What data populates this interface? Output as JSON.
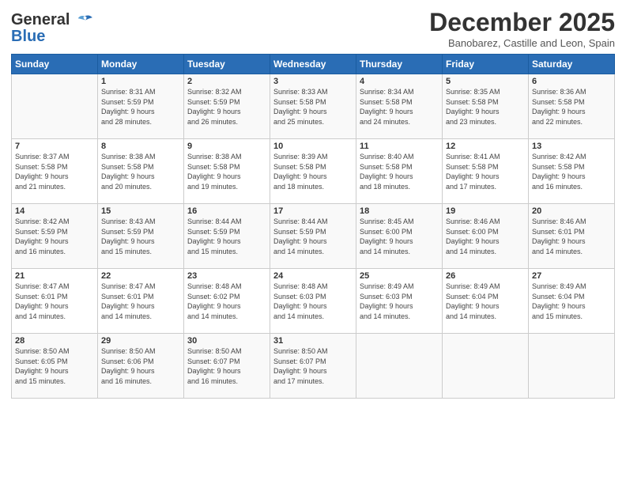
{
  "header": {
    "logo_line1": "General",
    "logo_line2": "Blue",
    "month": "December 2025",
    "location": "Banobarez, Castille and Leon, Spain"
  },
  "days_of_week": [
    "Sunday",
    "Monday",
    "Tuesday",
    "Wednesday",
    "Thursday",
    "Friday",
    "Saturday"
  ],
  "weeks": [
    [
      {
        "day": "",
        "info": ""
      },
      {
        "day": "1",
        "info": "Sunrise: 8:31 AM\nSunset: 5:59 PM\nDaylight: 9 hours\nand 28 minutes."
      },
      {
        "day": "2",
        "info": "Sunrise: 8:32 AM\nSunset: 5:59 PM\nDaylight: 9 hours\nand 26 minutes."
      },
      {
        "day": "3",
        "info": "Sunrise: 8:33 AM\nSunset: 5:58 PM\nDaylight: 9 hours\nand 25 minutes."
      },
      {
        "day": "4",
        "info": "Sunrise: 8:34 AM\nSunset: 5:58 PM\nDaylight: 9 hours\nand 24 minutes."
      },
      {
        "day": "5",
        "info": "Sunrise: 8:35 AM\nSunset: 5:58 PM\nDaylight: 9 hours\nand 23 minutes."
      },
      {
        "day": "6",
        "info": "Sunrise: 8:36 AM\nSunset: 5:58 PM\nDaylight: 9 hours\nand 22 minutes."
      }
    ],
    [
      {
        "day": "7",
        "info": "Sunrise: 8:37 AM\nSunset: 5:58 PM\nDaylight: 9 hours\nand 21 minutes."
      },
      {
        "day": "8",
        "info": "Sunrise: 8:38 AM\nSunset: 5:58 PM\nDaylight: 9 hours\nand 20 minutes."
      },
      {
        "day": "9",
        "info": "Sunrise: 8:38 AM\nSunset: 5:58 PM\nDaylight: 9 hours\nand 19 minutes."
      },
      {
        "day": "10",
        "info": "Sunrise: 8:39 AM\nSunset: 5:58 PM\nDaylight: 9 hours\nand 18 minutes."
      },
      {
        "day": "11",
        "info": "Sunrise: 8:40 AM\nSunset: 5:58 PM\nDaylight: 9 hours\nand 18 minutes."
      },
      {
        "day": "12",
        "info": "Sunrise: 8:41 AM\nSunset: 5:58 PM\nDaylight: 9 hours\nand 17 minutes."
      },
      {
        "day": "13",
        "info": "Sunrise: 8:42 AM\nSunset: 5:58 PM\nDaylight: 9 hours\nand 16 minutes."
      }
    ],
    [
      {
        "day": "14",
        "info": "Sunrise: 8:42 AM\nSunset: 5:59 PM\nDaylight: 9 hours\nand 16 minutes."
      },
      {
        "day": "15",
        "info": "Sunrise: 8:43 AM\nSunset: 5:59 PM\nDaylight: 9 hours\nand 15 minutes."
      },
      {
        "day": "16",
        "info": "Sunrise: 8:44 AM\nSunset: 5:59 PM\nDaylight: 9 hours\nand 15 minutes."
      },
      {
        "day": "17",
        "info": "Sunrise: 8:44 AM\nSunset: 5:59 PM\nDaylight: 9 hours\nand 14 minutes."
      },
      {
        "day": "18",
        "info": "Sunrise: 8:45 AM\nSunset: 6:00 PM\nDaylight: 9 hours\nand 14 minutes."
      },
      {
        "day": "19",
        "info": "Sunrise: 8:46 AM\nSunset: 6:00 PM\nDaylight: 9 hours\nand 14 minutes."
      },
      {
        "day": "20",
        "info": "Sunrise: 8:46 AM\nSunset: 6:01 PM\nDaylight: 9 hours\nand 14 minutes."
      }
    ],
    [
      {
        "day": "21",
        "info": "Sunrise: 8:47 AM\nSunset: 6:01 PM\nDaylight: 9 hours\nand 14 minutes."
      },
      {
        "day": "22",
        "info": "Sunrise: 8:47 AM\nSunset: 6:01 PM\nDaylight: 9 hours\nand 14 minutes."
      },
      {
        "day": "23",
        "info": "Sunrise: 8:48 AM\nSunset: 6:02 PM\nDaylight: 9 hours\nand 14 minutes."
      },
      {
        "day": "24",
        "info": "Sunrise: 8:48 AM\nSunset: 6:03 PM\nDaylight: 9 hours\nand 14 minutes."
      },
      {
        "day": "25",
        "info": "Sunrise: 8:49 AM\nSunset: 6:03 PM\nDaylight: 9 hours\nand 14 minutes."
      },
      {
        "day": "26",
        "info": "Sunrise: 8:49 AM\nSunset: 6:04 PM\nDaylight: 9 hours\nand 14 minutes."
      },
      {
        "day": "27",
        "info": "Sunrise: 8:49 AM\nSunset: 6:04 PM\nDaylight: 9 hours\nand 15 minutes."
      }
    ],
    [
      {
        "day": "28",
        "info": "Sunrise: 8:50 AM\nSunset: 6:05 PM\nDaylight: 9 hours\nand 15 minutes."
      },
      {
        "day": "29",
        "info": "Sunrise: 8:50 AM\nSunset: 6:06 PM\nDaylight: 9 hours\nand 16 minutes."
      },
      {
        "day": "30",
        "info": "Sunrise: 8:50 AM\nSunset: 6:07 PM\nDaylight: 9 hours\nand 16 minutes."
      },
      {
        "day": "31",
        "info": "Sunrise: 8:50 AM\nSunset: 6:07 PM\nDaylight: 9 hours\nand 17 minutes."
      },
      {
        "day": "",
        "info": ""
      },
      {
        "day": "",
        "info": ""
      },
      {
        "day": "",
        "info": ""
      }
    ]
  ]
}
